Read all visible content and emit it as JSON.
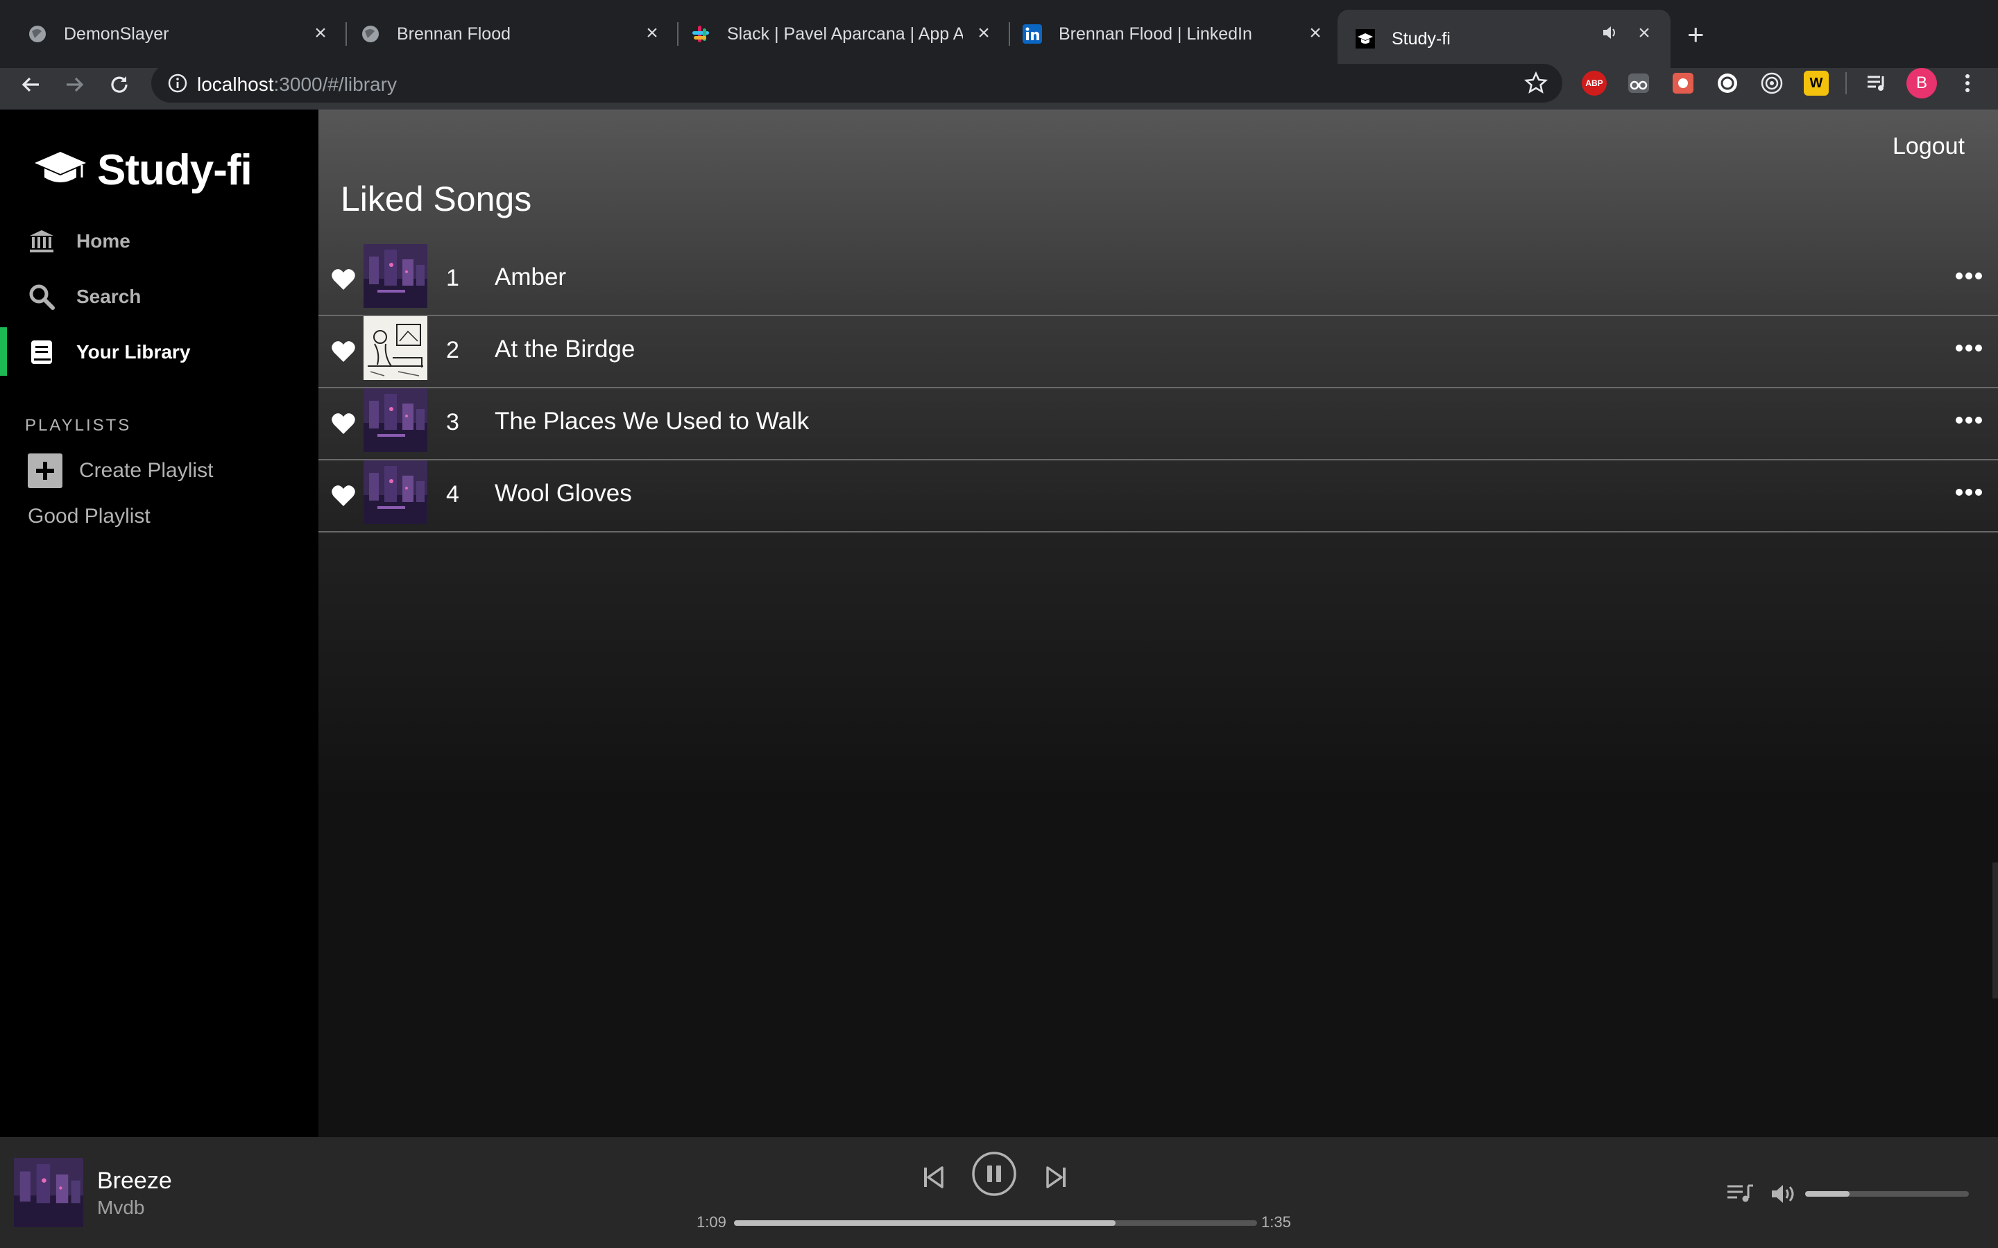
{
  "browser": {
    "tabs": [
      {
        "title": "DemonSlayer",
        "icon": "globe-icon"
      },
      {
        "title": "Brennan Flood",
        "icon": "globe-icon"
      },
      {
        "title": "Slack | Pavel Aparcana | App Ac",
        "icon": "slack-icon"
      },
      {
        "title": "Brennan Flood | LinkedIn",
        "icon": "linkedin-icon"
      },
      {
        "title": "Study-fi",
        "icon": "graduation-cap-icon",
        "active": true
      }
    ],
    "url_host": "localhost",
    "url_path": ":3000/#/library",
    "extensions": [
      "ABP",
      "",
      "",
      "",
      "",
      "W"
    ],
    "profile_initial": "B"
  },
  "app": {
    "name": "Study-fi",
    "nav": [
      {
        "label": "Home",
        "icon": "bank-icon"
      },
      {
        "label": "Search",
        "icon": "search-icon"
      },
      {
        "label": "Your Library",
        "icon": "library-icon",
        "active": true
      }
    ],
    "playlists_heading": "PLAYLISTS",
    "create_playlist_label": "Create Playlist",
    "playlists": [
      "Good Playlist"
    ],
    "accent_color": "#1db954"
  },
  "main": {
    "logout_label": "Logout",
    "title": "Liked Songs",
    "songs": [
      {
        "number": "1",
        "title": "Amber",
        "liked": true,
        "art": "purple-city"
      },
      {
        "number": "2",
        "title": "At the Birdge",
        "liked": true,
        "art": "sketch"
      },
      {
        "number": "3",
        "title": "The Places We Used to Walk",
        "liked": true,
        "art": "purple-city"
      },
      {
        "number": "4",
        "title": "Wool Gloves",
        "liked": true,
        "art": "purple-city"
      }
    ]
  },
  "player": {
    "title": "Breeze",
    "artist": "Mvdb",
    "elapsed": "1:09",
    "duration": "1:35",
    "progress_fraction": 0.73,
    "volume_fraction": 0.27,
    "state": "playing"
  }
}
